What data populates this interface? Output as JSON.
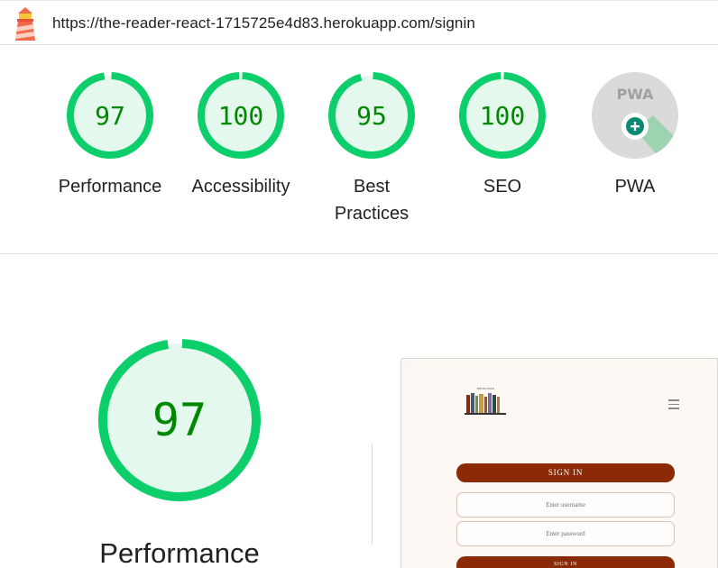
{
  "header": {
    "url": "https://the-reader-react-1715725e4d83.herokuapp.com/signin"
  },
  "gauges": [
    {
      "label": "Performance",
      "score": "97",
      "value": 0.97
    },
    {
      "label": "Accessibility",
      "score": "100",
      "value": 1.0
    },
    {
      "label": "Best Practices",
      "score": "95",
      "value": 0.95
    },
    {
      "label": "SEO",
      "score": "100",
      "value": 1.0
    },
    {
      "label": "PWA",
      "badge": "PWA"
    }
  ],
  "performance": {
    "score": "97",
    "value": 0.97,
    "label": "Performance"
  },
  "screenshot": {
    "brand_text": "THE READER",
    "signin_heading": "SIGN IN",
    "username_placeholder": "Enter username",
    "password_placeholder": "Enter password",
    "submit_label": "SIGN IN"
  },
  "colors": {
    "pass_green": "#0cce6b",
    "pass_fill": "#e5f8ee",
    "pass_text": "#008800",
    "brand_brown": "#8b2a06",
    "pwa_grey": "#dadada"
  }
}
